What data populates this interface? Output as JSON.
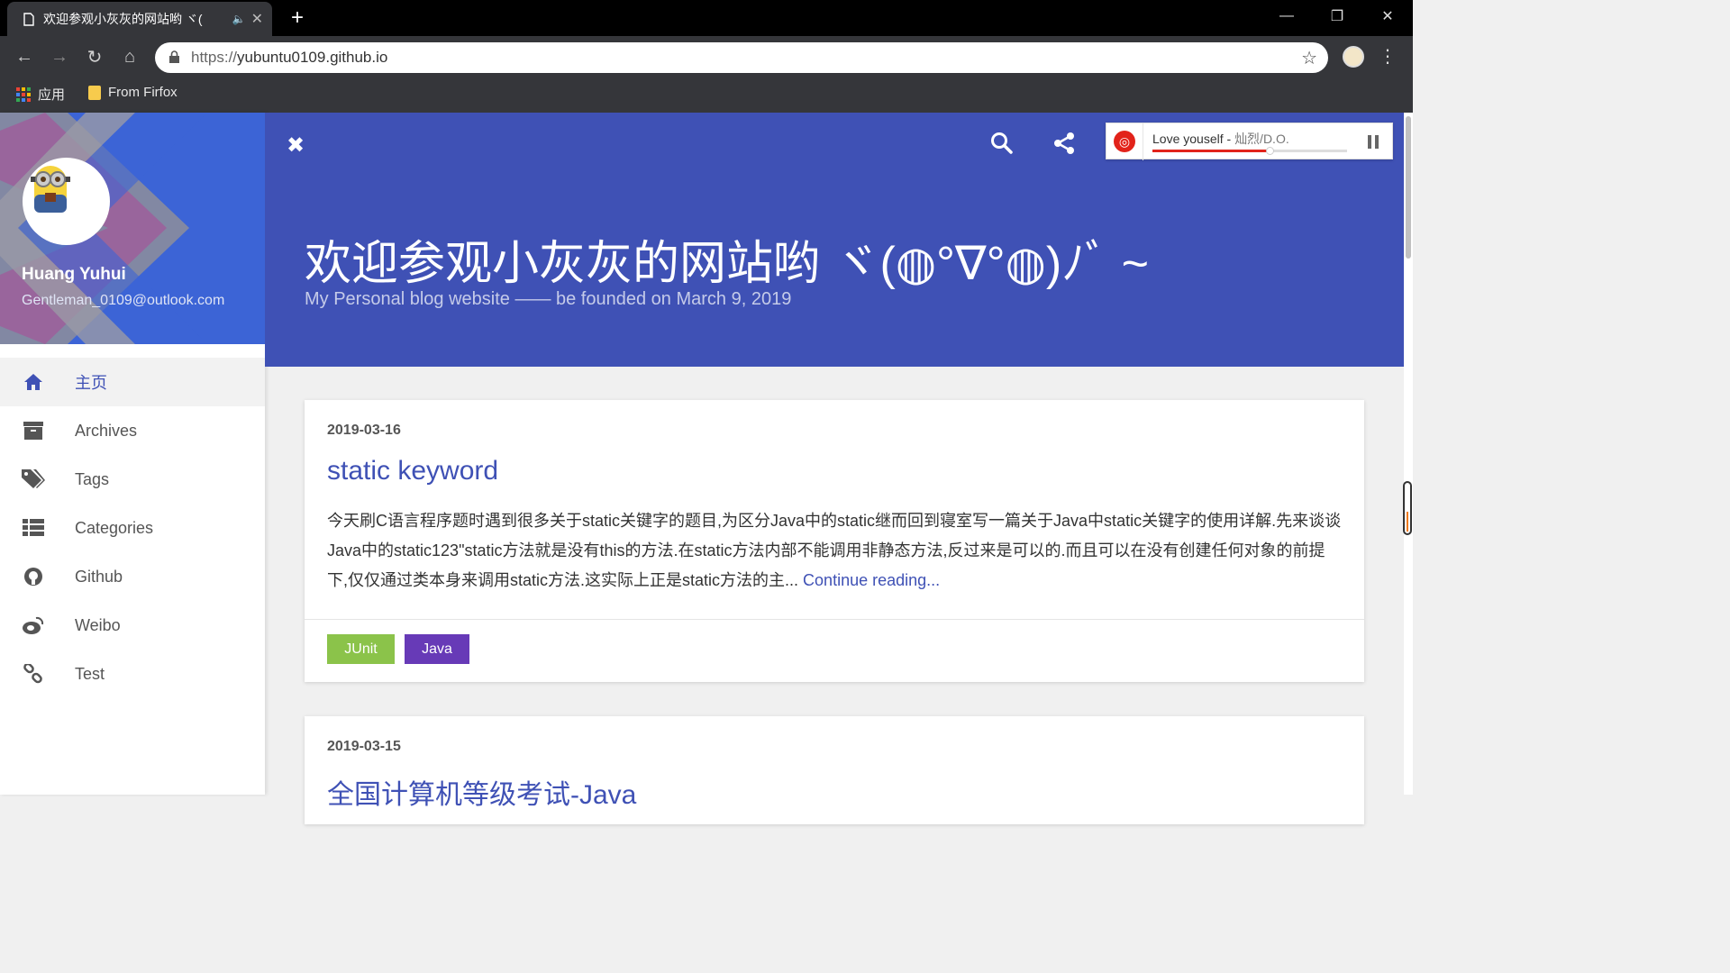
{
  "browser": {
    "tab_title": "欢迎参观小灰灰的网站哟 ヾ(",
    "url_scheme": "https://",
    "url_host": "yubuntu0109.github.io",
    "bookmarks": [
      {
        "label": "应用",
        "icon": "apps-grid-icon"
      },
      {
        "label": "From Firfox",
        "icon": "folder-icon"
      }
    ],
    "colors": {
      "tabbar": "#000000",
      "toolbar": "#35363a"
    }
  },
  "sidebar": {
    "name": "Huang Yuhui",
    "email": "Gentleman_0109@outlook.com",
    "items": [
      {
        "label": "主页",
        "icon": "home-icon",
        "active": true
      },
      {
        "label": "Archives",
        "icon": "archive-icon"
      },
      {
        "label": "Tags",
        "icon": "tags-icon"
      },
      {
        "label": "Categories",
        "icon": "list-icon"
      },
      {
        "label": "Github",
        "icon": "github-icon"
      },
      {
        "label": "Weibo",
        "icon": "weibo-icon"
      },
      {
        "label": "Test",
        "icon": "link-icon"
      }
    ]
  },
  "header": {
    "title": "欢迎参观小灰灰的网站哟 ヾ(◍°∇°◍)ﾉﾞ ~",
    "subtitle": "My Personal blog website —— be founded on March 9, 2019",
    "bg_color": "#3f51b5"
  },
  "player": {
    "song": "Love youself - ",
    "artist": "灿烈/D.O.",
    "progress": 0.6
  },
  "posts": [
    {
      "date": "2019-03-16",
      "title": "static keyword",
      "excerpt": "今天刷C语言程序题时遇到很多关于static关键字的题目,为区分Java中的static继而回到寝室写一篇关于Java中static关键字的使用详解.先来谈谈Java中的static123\"static方法就是没有this的方法.在static方法内部不能调用非静态方法,反过来是可以的.而且可以在没有创建任何对象的前提下,仅仅通过类本身来调用static方法.这实际上正是static方法的主...",
      "more": "Continue reading...",
      "tags": [
        {
          "label": "JUnit",
          "color": "#8bc34a"
        },
        {
          "label": "Java",
          "color": "#673ab7"
        }
      ]
    },
    {
      "date": "2019-03-15",
      "title": "全国计算机等级考试-Java"
    }
  ]
}
